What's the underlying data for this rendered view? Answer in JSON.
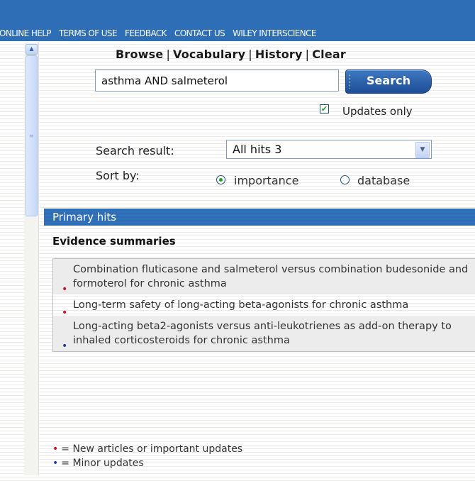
{
  "topnav": {
    "items": [
      "ONLINE HELP",
      "TERMS OF USE",
      "FEEDBACK",
      "CONTACT US",
      "WILEY INTERSCIENCE"
    ]
  },
  "tools": {
    "browse": "Browse",
    "vocabulary": "Vocabulary",
    "history": "History",
    "clear": "Clear",
    "separator": "|"
  },
  "search": {
    "value": "asthma AND salmeterol",
    "button_label": "Search",
    "updates_only_label": "Updates only",
    "updates_only_checked": true
  },
  "results": {
    "result_label": "Search result:",
    "result_value": "All hits 3",
    "sort_label": "Sort by:",
    "sort_options": [
      "importance",
      "database"
    ],
    "sort_selected": "importance"
  },
  "primary": {
    "bar_title": "Primary hits",
    "section_title": "Evidence summaries",
    "hits": [
      {
        "text": "Combination fluticasone and salmeterol versus combination budesonide and formoterol for chronic asthma",
        "status": "new"
      },
      {
        "text": "Long-term safety of long-acting beta-agonists for chronic asthma",
        "status": "new"
      },
      {
        "text": "Long-acting beta2-agonists versus anti-leukotrienes as add-on therapy to inhaled corticosteroids for chronic asthma",
        "status": "minor"
      }
    ]
  },
  "legend": {
    "bullet": "•",
    "new_text": "= New articles or important updates",
    "minor_text": "= Minor updates"
  },
  "colors": {
    "header_blue": "#2e6eb6",
    "new_dot": "#c8102e",
    "minor_dot": "#1c3fa8",
    "check_green": "#21a121"
  },
  "icons": {
    "scroll_up": "chevron-up-icon",
    "dropdown": "chevron-down-icon",
    "checkbox": "check-icon"
  }
}
